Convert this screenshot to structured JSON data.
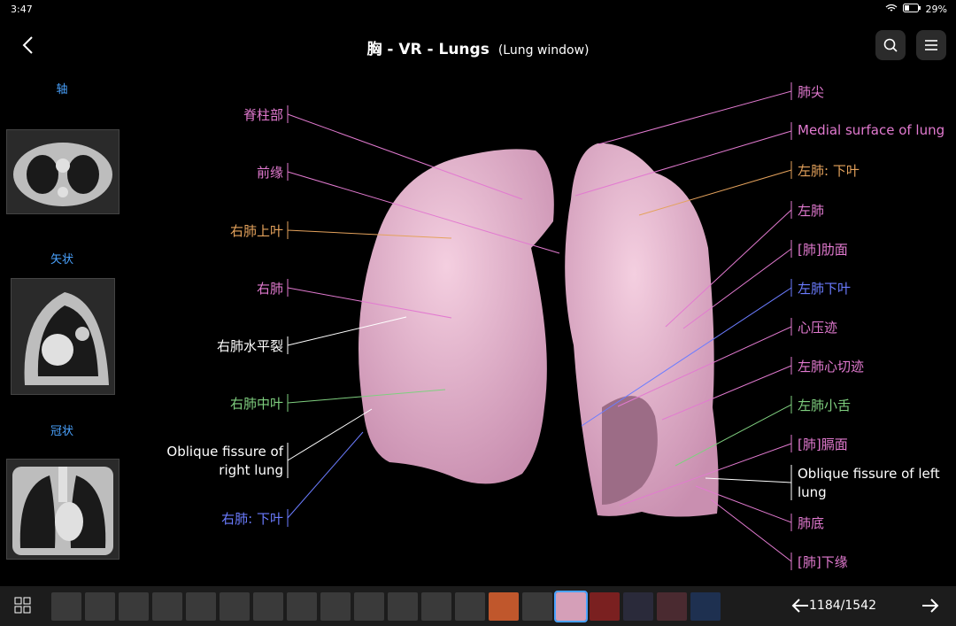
{
  "status": {
    "time": "3:47",
    "battery": "29%"
  },
  "header": {
    "title": "胸 - VR - Lungs",
    "subtitle": "(Lung window)"
  },
  "views": [
    {
      "label": "轴"
    },
    {
      "label": "矢状"
    },
    {
      "label": "冠状"
    }
  ],
  "labels_left": [
    "脊柱部",
    "前缘",
    "右肺上叶",
    "右肺",
    "右肺水平裂",
    "右肺中叶",
    "Oblique fissure of right lung",
    "右肺: 下叶"
  ],
  "labels_right": [
    "肺尖",
    "Medial surface of lung",
    "左肺: 下叶",
    "左肺",
    "[肺]肋面",
    "左肺下叶",
    "心压迹",
    "左肺心切迹",
    "左肺小舌",
    "[肺]膈面",
    "Oblique fissure of left lung",
    "肺底",
    "[肺]下缘"
  ],
  "colors": {
    "pink": "#e27ad0",
    "orange": "#e4a25c",
    "green": "#7fcf7f",
    "blue": "#6b7cff",
    "white": "#ffffff",
    "lung": "#e9b8cc",
    "accent": "#4aa3ff"
  },
  "pager": {
    "current": "1184",
    "total": "1542",
    "text": "1184/1542"
  }
}
